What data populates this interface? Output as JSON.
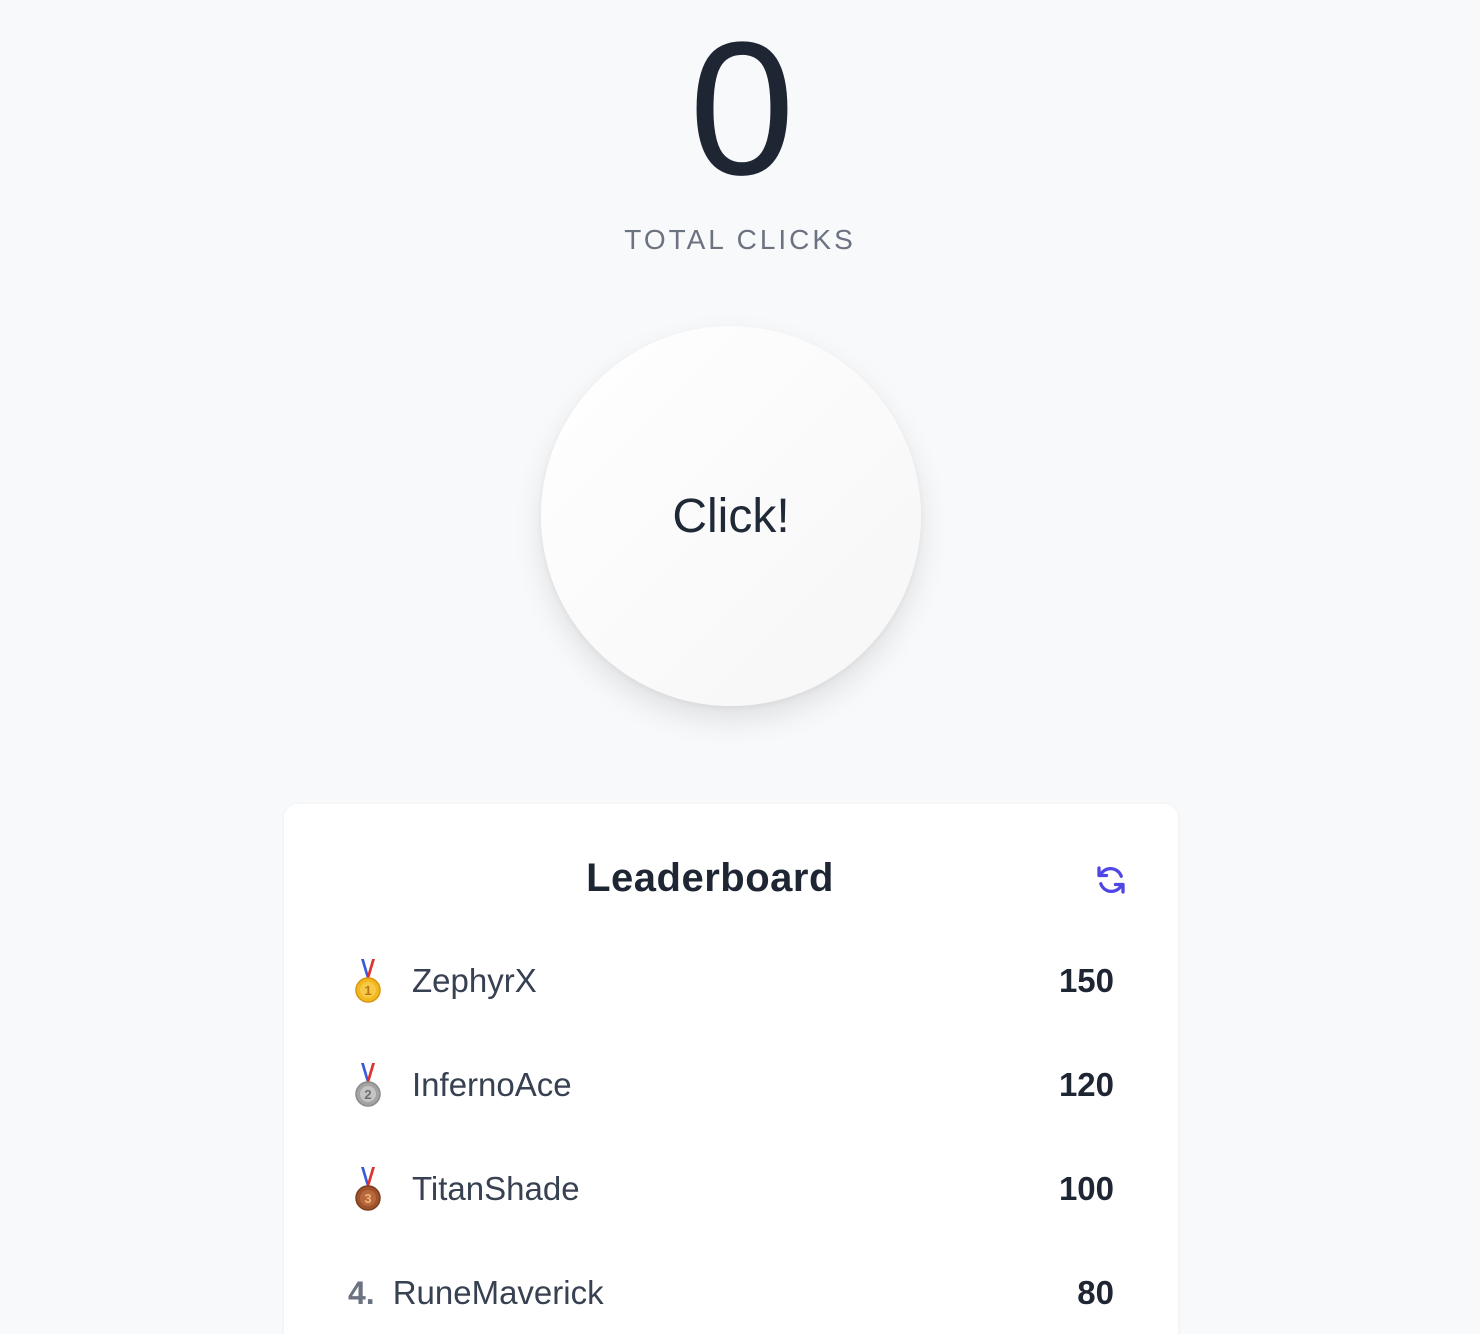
{
  "counter": {
    "value": "0",
    "label": "TOTAL CLICKS"
  },
  "click_button": {
    "label": "Click!"
  },
  "leaderboard": {
    "title": "Leaderboard",
    "refresh_icon": "refresh-icon",
    "accent_color": "#4f46e5",
    "entries": [
      {
        "rank": "1",
        "medal": "gold-medal-icon",
        "name": "ZephyrX",
        "score": "150"
      },
      {
        "rank": "2",
        "medal": "silver-medal-icon",
        "name": "InfernoAce",
        "score": "120"
      },
      {
        "rank": "3",
        "medal": "bronze-medal-icon",
        "name": "TitanShade",
        "score": "100"
      },
      {
        "rank": "4.",
        "medal": "",
        "name": "RuneMaverick",
        "score": "80"
      }
    ]
  }
}
